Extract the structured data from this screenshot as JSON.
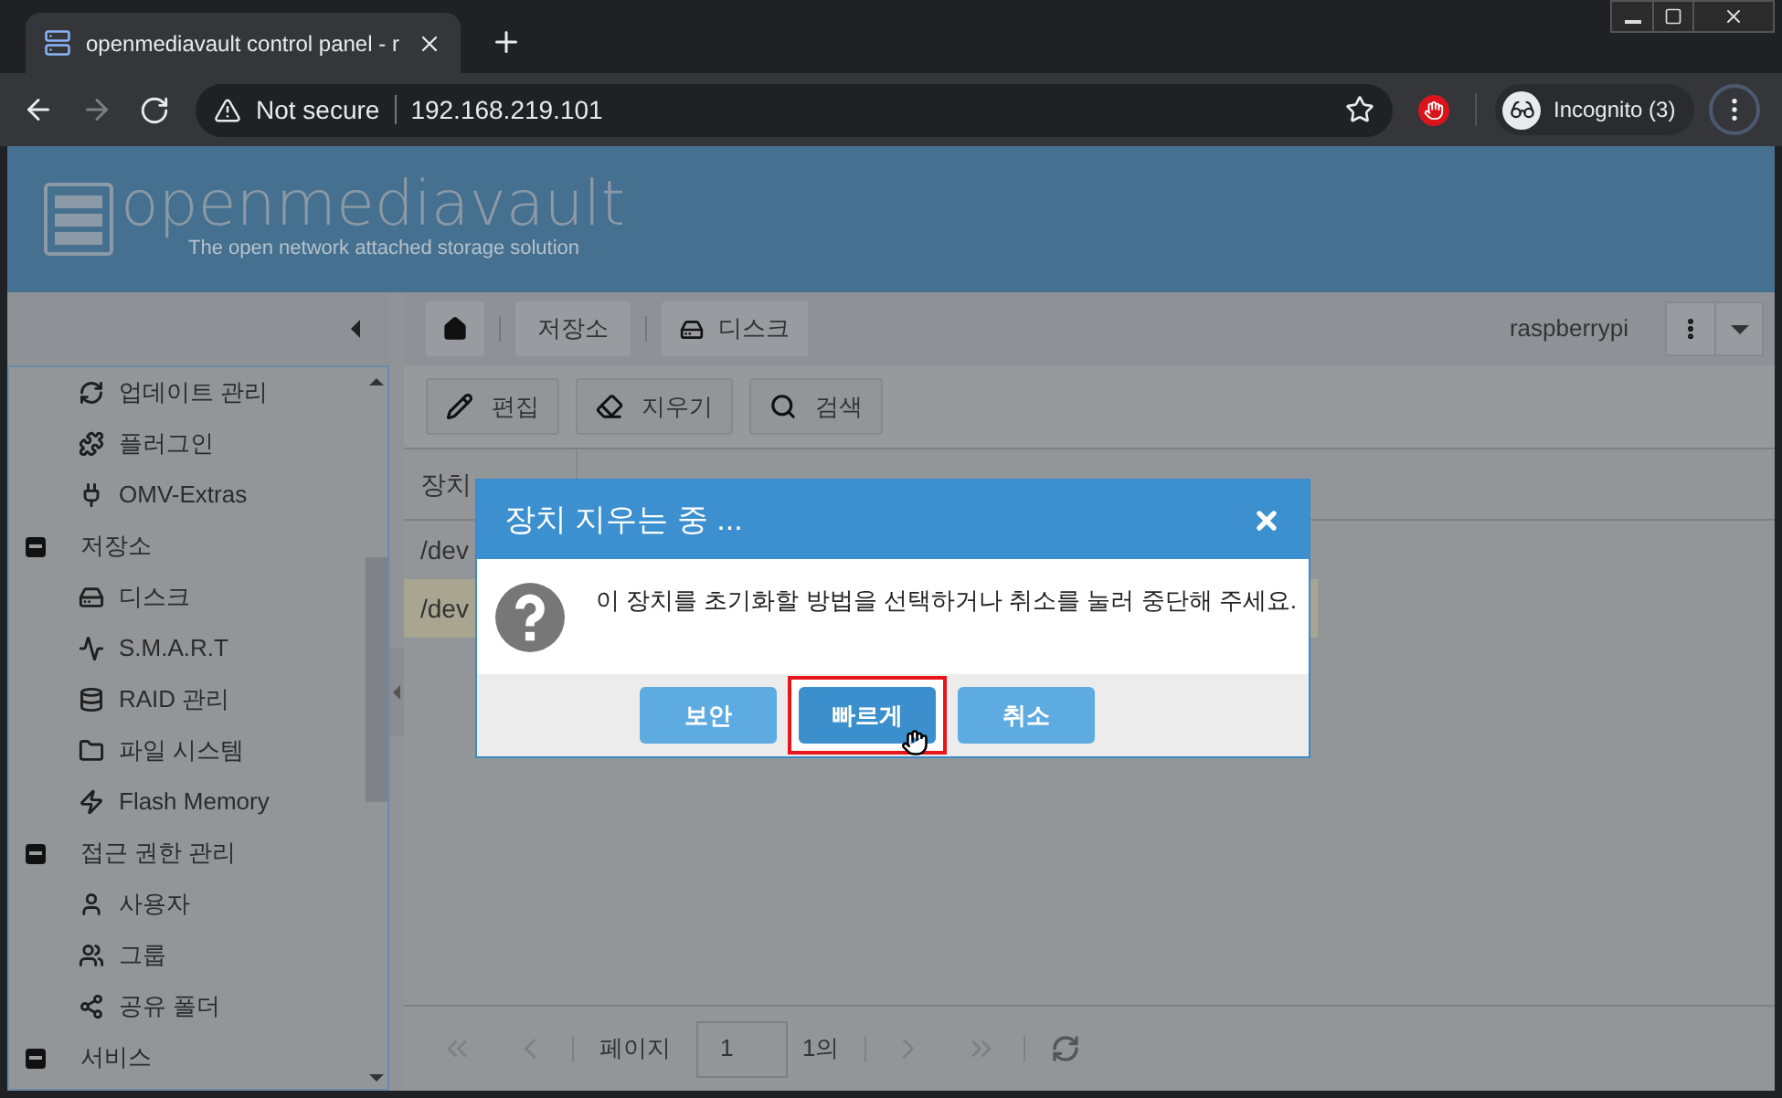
{
  "browser": {
    "tab_title": "openmediavault control panel - r",
    "security": "Not secure",
    "address": "192.168.219.101",
    "profile": "Incognito (3)"
  },
  "header": {
    "logo": "openmediavault",
    "tagline": "The open network attached storage solution"
  },
  "sidebar": {
    "items": [
      {
        "label": "업데이트 관리"
      },
      {
        "label": "플러그인"
      },
      {
        "label": "OMV-Extras"
      },
      {
        "label": "저장소",
        "expanded": true,
        "children": [
          {
            "label": "디스크"
          },
          {
            "label": "S.M.A.R.T"
          },
          {
            "label": "RAID 관리"
          },
          {
            "label": "파일 시스템"
          },
          {
            "label": "Flash Memory"
          }
        ]
      },
      {
        "label": "접근 권한 관리",
        "expanded": true,
        "children": [
          {
            "label": "사용자"
          },
          {
            "label": "그룹"
          },
          {
            "label": "공유 폴더"
          }
        ]
      },
      {
        "label": "서비스",
        "expanded": true
      }
    ]
  },
  "breadcrumb": [
    "저장소",
    "디스크"
  ],
  "hostname": "raspberrypi",
  "toolbar": [
    "편집",
    "지우기",
    "검색"
  ],
  "table": {
    "columns": [
      "장치"
    ],
    "rows": [
      {
        "cells": [
          "/dev"
        ],
        "selected": false
      },
      {
        "cells": [
          "/dev"
        ],
        "selected": true
      }
    ]
  },
  "pager": {
    "label": "페이지",
    "page": "1",
    "of": "1의"
  },
  "dialog": {
    "title": "장치 지우는 중 ...",
    "message": "이 장치를 초기화할 방법을 선택하거나 취소를 눌러 중단해 주세요.",
    "buttons": [
      {
        "label": "보안",
        "selected": false
      },
      {
        "label": "빠르게",
        "selected": true
      },
      {
        "label": "취소",
        "selected": false
      }
    ]
  }
}
